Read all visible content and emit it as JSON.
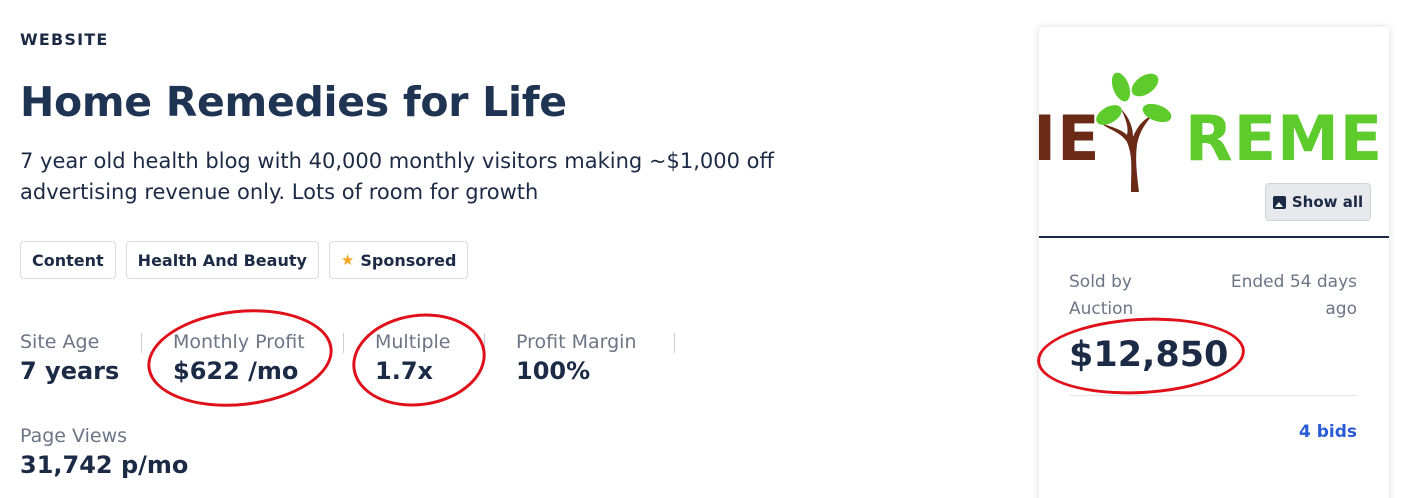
{
  "listing": {
    "category": "WEBSITE",
    "title": "Home Remedies for Life",
    "description": "7 year old health blog with 40,000 monthly visitors making ~$1,000 off advertising revenue only. Lots of room for growth"
  },
  "tags": [
    {
      "label": "Content"
    },
    {
      "label": "Health And Beauty"
    },
    {
      "label": "Sponsored",
      "icon": "star-icon",
      "icon_color": "#f5a623"
    }
  ],
  "metrics": {
    "site_age": {
      "label": "Site Age",
      "value": "7 years"
    },
    "monthly_profit": {
      "label": "Monthly Profit",
      "value": "$622 /mo"
    },
    "multiple": {
      "label": "Multiple",
      "value": "1.7x"
    },
    "profit_margin": {
      "label": "Profit Margin",
      "value": "100%"
    },
    "page_views": {
      "label": "Page Views",
      "value": "31,742 p/mo"
    }
  },
  "card": {
    "logo_text_left": "IE",
    "logo_text_right": "REME",
    "logo_colors": {
      "brown": "#6b2a16",
      "green": "#5ccb2b"
    },
    "show_all_label": "Show all",
    "sold_by": "Sold by Auction",
    "ended": "Ended 54 days ago",
    "price": "$12,850",
    "bids": "4 bids"
  },
  "colors": {
    "text": "#1c2b45",
    "muted": "#6b7585",
    "link": "#2a5bd7",
    "annotation": "#e0101a"
  }
}
